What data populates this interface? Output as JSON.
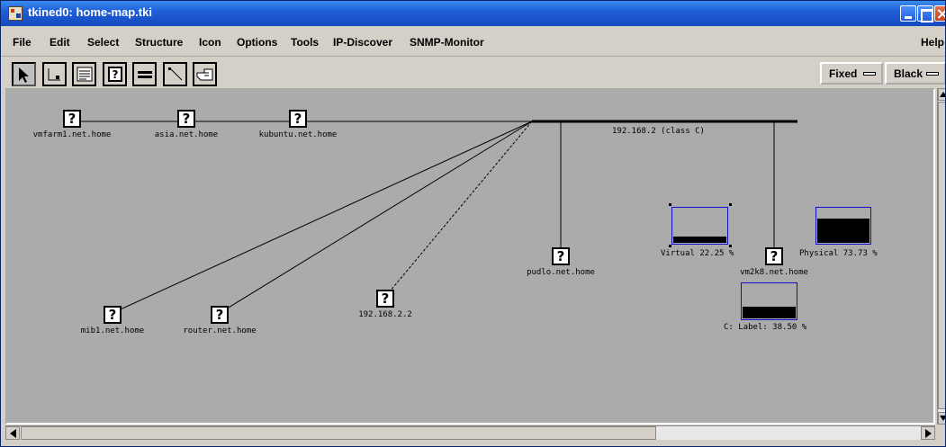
{
  "window": {
    "title": "tkined0: home-map.tki"
  },
  "menu": {
    "items": [
      "File",
      "Edit",
      "Select",
      "Structure",
      "Icon",
      "Options",
      "Tools",
      "IP-Discover",
      "SNMP-Monitor"
    ],
    "help": "Help"
  },
  "toolbar": {
    "tools": [
      "select-tool",
      "resize-tool",
      "text-tool",
      "node-tool",
      "network-tool",
      "link-tool",
      "group-tool"
    ],
    "font_select": "Fixed",
    "color_select": "Black"
  },
  "map": {
    "network": {
      "label": "192.168.2 (class C)"
    },
    "nodes": [
      {
        "label": "vmfarm1.net.home",
        "icon": "unknown-node-icon"
      },
      {
        "label": "asia.net.home",
        "icon": "unknown-node-icon"
      },
      {
        "label": "kubuntu.net.home",
        "icon": "unknown-node-icon"
      },
      {
        "label": "mib1.net.home",
        "icon": "unknown-node-icon"
      },
      {
        "label": "router.net.home",
        "icon": "unknown-node-icon"
      },
      {
        "label": "192.168.2.2",
        "icon": "unknown-node-icon"
      },
      {
        "label": "pudlo.net.home",
        "icon": "unknown-node-icon"
      },
      {
        "label": "vm2k8.net.home",
        "icon": "unknown-node-icon"
      }
    ],
    "node_icon_glyph": "?",
    "bargraphs": [
      {
        "label": "Virtual 22.25 %",
        "value_percent": 22.25
      },
      {
        "label": "Physical 73.73 %",
        "value_percent": 73.73
      },
      {
        "label": "C: Label: 38.50 %",
        "value_percent": 38.5
      }
    ]
  },
  "colors": {
    "canvas_bg": "#ababab",
    "title_bar": "#1f5fd6",
    "meter_border": "#1010d0",
    "line": "#000000"
  }
}
